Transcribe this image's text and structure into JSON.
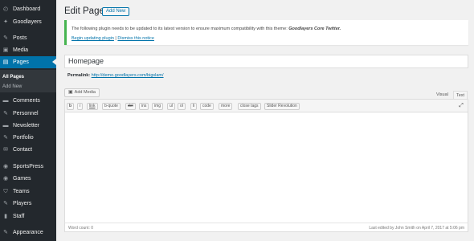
{
  "sidebar": {
    "items": [
      {
        "label": "Dashboard",
        "icon": "dashboard-icon",
        "glyph": "◴"
      },
      {
        "label": "Goodlayers",
        "icon": "goodlayers-icon",
        "glyph": "✦"
      },
      {
        "label": "Posts",
        "icon": "pin-icon",
        "glyph": "✎"
      },
      {
        "label": "Media",
        "icon": "media-icon",
        "glyph": "▣"
      },
      {
        "label": "Pages",
        "icon": "pages-icon",
        "glyph": "▤"
      },
      {
        "label": "Comments",
        "icon": "comments-icon",
        "glyph": "▬"
      },
      {
        "label": "Personnel",
        "icon": "pin-icon",
        "glyph": "✎"
      },
      {
        "label": "Newsletter",
        "icon": "newsletter-icon",
        "glyph": "▬"
      },
      {
        "label": "Portfolio",
        "icon": "pin-icon",
        "glyph": "✎"
      },
      {
        "label": "Contact",
        "icon": "mail-icon",
        "glyph": "✉"
      },
      {
        "label": "SportsPress",
        "icon": "sportspress-icon",
        "glyph": "◉"
      },
      {
        "label": "Games",
        "icon": "games-icon",
        "glyph": "◉"
      },
      {
        "label": "Teams",
        "icon": "shield-icon",
        "glyph": "⛉"
      },
      {
        "label": "Players",
        "icon": "pin-icon",
        "glyph": "✎"
      },
      {
        "label": "Staff",
        "icon": "staff-icon",
        "glyph": "▮"
      },
      {
        "label": "Appearance",
        "icon": "brush-icon",
        "glyph": "✎"
      }
    ],
    "submenu": {
      "all_pages": "All Pages",
      "add_new": "Add New"
    }
  },
  "header": {
    "title": "Edit Page",
    "add_new": "Add New"
  },
  "notice": {
    "text_prefix": "The following plugin needs to be updated to its latest version to ensure maximum compatibility with this theme: ",
    "plugin": "Goodlayers Core Twitter.",
    "link_update": "Begin updating plugin",
    "separator": " | ",
    "link_dismiss": "Dismiss this notice"
  },
  "editor": {
    "title_value": "Homepage",
    "permalink_label": "Permalink:",
    "permalink_url": "http://demo.goodlayers.com/bigslam/",
    "add_media": "Add Media",
    "tab_visual": "Visual",
    "tab_text": "Text",
    "toolbar": [
      "b",
      "i",
      "link",
      "b-quote",
      "del",
      "ins",
      "img",
      "ul",
      "ol",
      "li",
      "code",
      "more",
      "close tags",
      "Slider Revolution"
    ],
    "word_count": "Word count: 0",
    "last_edited": "Last edited by John Smith on April 7, 2017 at 5:06 pm"
  },
  "colors": {
    "sidebar_bg": "#23282d",
    "accent": "#0073aa",
    "notice_border": "#46b450"
  }
}
